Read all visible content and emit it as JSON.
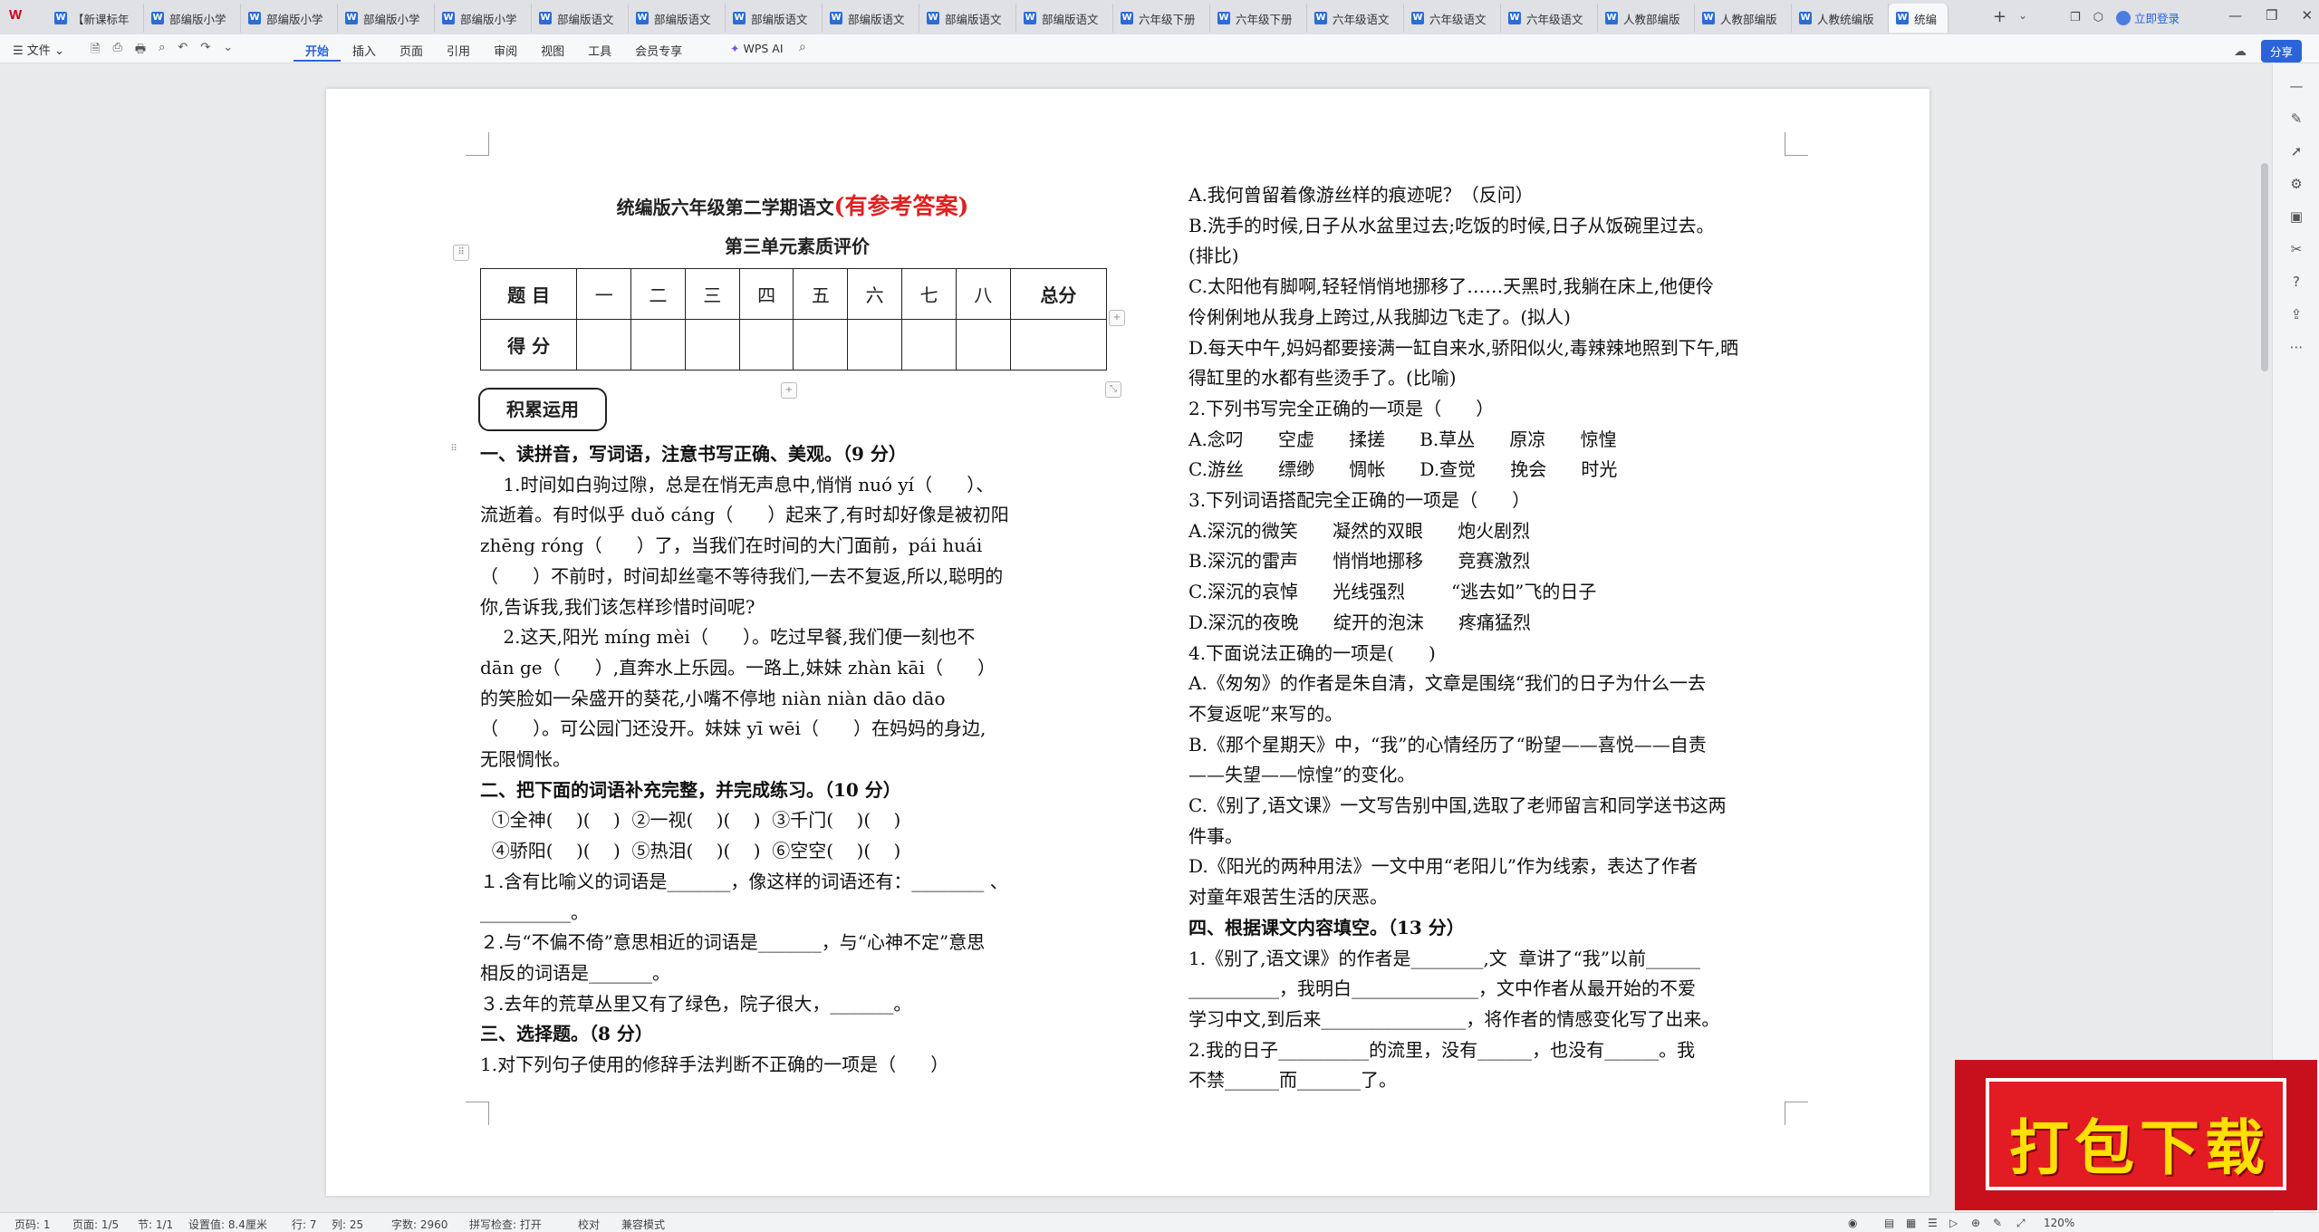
{
  "tabbar": {
    "tabs": [
      "【新课标年",
      "部编版小学",
      "部编版小学",
      "部编版小学",
      "部编版小学",
      "部编版语文",
      "部编版语文",
      "部编版语文",
      "部编版语文",
      "部编版语文",
      "部编版语文",
      "六年级下册",
      "六年级下册",
      "六年级语文",
      "六年级语文",
      "六年级语文",
      "人教部编版",
      "人教部编版",
      "人教统编版",
      "统编"
    ],
    "active_index": 19,
    "login_label": "立即登录"
  },
  "toolbar": {
    "file_label": "文件",
    "ribbon_tabs": [
      "开始",
      "插入",
      "页面",
      "引用",
      "审阅",
      "视图",
      "工具",
      "会员专享"
    ],
    "active_tab": "开始",
    "wps_ai_label": "WPS AI",
    "share_label": "分享"
  },
  "document": {
    "title_main": "统编版六年级第二学期语文",
    "title_red": "(有参考答案)",
    "subtitle": "第三单元素质评价",
    "score_table": {
      "header": [
        "题 目",
        "一",
        "二",
        "三",
        "四",
        "五",
        "六",
        "七",
        "八",
        "总分"
      ],
      "row2_label": "得 分"
    },
    "section_box": "积累运用",
    "left_lines": [
      {
        "text": "一、读拼音，写词语，注意书写正确、美观。（9 分）",
        "bold": true
      },
      {
        "text": "    1.时间如白驹过隙，总是在悄无声息中,悄悄 nuó yí（      ）、"
      },
      {
        "text": "流逝着。有时似乎 duǒ cáng（      ）起来了,有时却好像是被初阳"
      },
      {
        "text": "zhēng róng（      ）了，当我们在时间的大门面前，pái huái"
      },
      {
        "text": "（      ）不前时，时间却丝毫不等待我们,一去不复返,所以,聪明的"
      },
      {
        "text": "你,告诉我,我们该怎样珍惜时间呢?"
      },
      {
        "text": "    2.这天,阳光 míng mèi（      ）。吃过早餐,我们便一刻也不"
      },
      {
        "text": "dān ge（      ）,直奔水上乐园。一路上,妹妹 zhàn kāi（      ）"
      },
      {
        "text": "的笑脸如一朵盛开的葵花,小嘴不停地 niàn niàn dāo dāo"
      },
      {
        "text": "（      ）。可公园门还没开。妹妹 yī wēi（      ）在妈妈的身边,"
      },
      {
        "text": "无限惆怅。"
      },
      {
        "text": "二、把下面的词语补充完整，并完成练习。（10 分）",
        "bold": true
      },
      {
        "text": "  ①全神(    )(    )  ②一视(    )(    )  ③千门(    )(    )"
      },
      {
        "text": "  ④骄阳(    )(    )  ⑤热泪(    )(    )  ⑥空空(    )(    )"
      },
      {
        "text": "１.含有比喻义的词语是_______，像这样的词语还有：________ 、"
      },
      {
        "text": "__________。"
      },
      {
        "text": "２.与“不偏不倚”意思相近的词语是_______，与“心神不定”意思"
      },
      {
        "text": "相反的词语是_______。"
      },
      {
        "text": "３.去年的荒草丛里又有了绿色，院子很大，_______。"
      },
      {
        "text": "三、选择题。（8 分）",
        "bold": true
      },
      {
        "text": "1.对下列句子使用的修辞手法判断不正确的一项是（      ）"
      }
    ],
    "right_lines": [
      {
        "text": "A.我何曾留着像游丝样的痕迹呢？（反问）"
      },
      {
        "text": "B.洗手的时候,日子从水盆里过去;吃饭的时候,日子从饭碗里过去。"
      },
      {
        "text": "(排比)"
      },
      {
        "text": "C.太阳他有脚啊,轻轻悄悄地挪移了……天黑时,我躺在床上,他便伶"
      },
      {
        "text": "伶俐俐地从我身上跨过,从我脚边飞走了。(拟人)"
      },
      {
        "text": "D.每天中午,妈妈都要接满一缸自来水,骄阳似火,毒辣辣地照到下午,晒"
      },
      {
        "text": "得缸里的水都有些烫手了。(比喻)"
      },
      {
        "text": "2.下列书写完全正确的一项是（      ）"
      },
      {
        "text": "A.念叼      空虚      揉搓      B.草丛      原凉      惊惶"
      },
      {
        "text": "C.游丝      缥缈      惆帐      D.查觉      挽会      时光"
      },
      {
        "text": "3.下列词语搭配完全正确的一项是（      ）"
      },
      {
        "text": "A.深沉的微笑      凝然的双眼      炮火剧烈"
      },
      {
        "text": "B.深沉的雷声      悄悄地挪移      竞赛激烈"
      },
      {
        "text": "C.深沉的哀悼      光线强烈        “逃去如”飞的日子"
      },
      {
        "text": "D.深沉的夜晚      绽开的泡沫      疼痛猛烈"
      },
      {
        "text": "4.下面说法正确的一项是(      )"
      },
      {
        "text": "A.《匆匆》的作者是朱自清，文章是围绕“我们的日子为什么一去"
      },
      {
        "text": "不复返呢”来写的。"
      },
      {
        "text": "B.《那个星期天》中，“我”的心情经历了“盼望——喜悦——自责"
      },
      {
        "text": "——失望——惊惶”的变化。"
      },
      {
        "text": "C.《别了,语文课》一文写告别中国,选取了老师留言和同学送书这两"
      },
      {
        "text": "件事。"
      },
      {
        "text": "D.《阳光的两种用法》一文中用“老阳儿”作为线索，表达了作者"
      },
      {
        "text": "对童年艰苦生活的厌恶。"
      },
      {
        "text": "四、根据课文内容填空。（13 分）",
        "bold": true
      },
      {
        "text": "1.《别了,语文课》的作者是________,文  章讲了“我”以前______"
      },
      {
        "text": "__________，我明白______________，文中作者从最开始的不爱"
      },
      {
        "text": "学习中文,到后来________________，将作者的情感变化写了出来。"
      },
      {
        "text": "2.我的日子__________的流里，没有______，也没有______。我"
      },
      {
        "text": "不禁______而_______了。"
      }
    ]
  },
  "statusbar": {
    "page_label": "页码: 1",
    "pages_label": "页面: 1/5",
    "section_label": "节: 1/1",
    "setting_label": "设置值: 8.4厘米",
    "row_label": "行: 7",
    "col_label": "列: 25",
    "wordcount_label": "字数: 2960",
    "spellcheck_label": "拼写检查: 打开",
    "proof_label": "校对",
    "compat_label": "兼容模式",
    "zoom_label": "120%"
  },
  "banner": {
    "text": "打包下载"
  },
  "colors": {
    "accent": "#2b64d8",
    "title_red": "#e02020",
    "banner_red": "#e31b23",
    "banner_text": "#ffe000"
  }
}
